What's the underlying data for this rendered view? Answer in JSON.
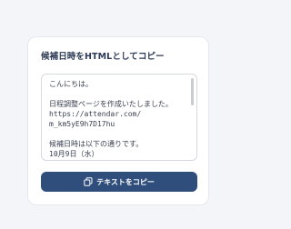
{
  "card": {
    "title": "候補日時をHTMLとしてコピー"
  },
  "textbox": {
    "content": "こんにちは。\n\n日程調整ページを作成いたしました。\nhttps://attendar.com/\nm_km5yE9h7D17hu\n\n候補日時は以下の通りです。\n10月9日（水）"
  },
  "copy_button": {
    "label": "テキストをコピー",
    "icon": "copy-icon"
  },
  "colors": {
    "background": "#f4f5f9",
    "card": "#ffffff",
    "title": "#2d3a55",
    "button": "#2f4e7c",
    "button_text": "#ffffff"
  }
}
